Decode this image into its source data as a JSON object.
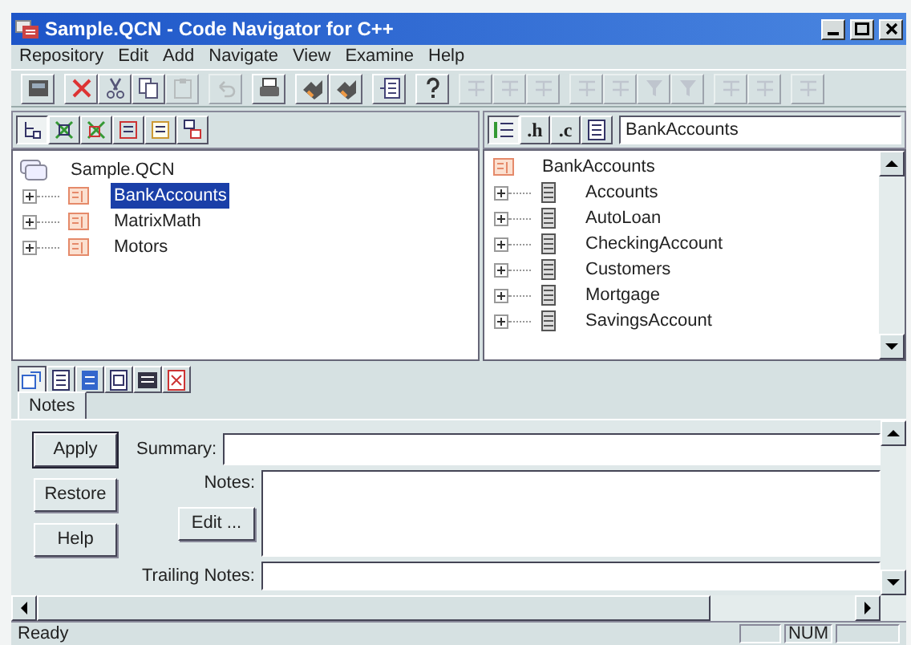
{
  "window": {
    "title": "Sample.QCN - Code Navigator for C++"
  },
  "menu": [
    "Repository",
    "Edit",
    "Add",
    "Navigate",
    "View",
    "Examine",
    "Help"
  ],
  "toolbar": [
    [
      {
        "kind": "database",
        "disabled": false
      }
    ],
    [
      {
        "kind": "delete",
        "disabled": false
      },
      {
        "kind": "cut",
        "disabled": false
      },
      {
        "kind": "copy",
        "disabled": false
      },
      {
        "kind": "paste",
        "disabled": true
      }
    ],
    [
      {
        "kind": "undo",
        "disabled": true
      }
    ],
    [
      {
        "kind": "print",
        "disabled": false
      }
    ],
    [
      {
        "kind": "link",
        "disabled": false
      },
      {
        "kind": "link",
        "disabled": false
      }
    ],
    [
      {
        "kind": "window",
        "disabled": false
      }
    ],
    [
      {
        "kind": "help",
        "disabled": false
      }
    ],
    [
      {
        "kind": "grid",
        "disabled": true
      },
      {
        "kind": "grid",
        "disabled": true
      },
      {
        "kind": "grid",
        "disabled": true
      }
    ],
    [
      {
        "kind": "grid",
        "disabled": true
      },
      {
        "kind": "grid",
        "disabled": true
      },
      {
        "kind": "filter",
        "disabled": true
      },
      {
        "kind": "filter",
        "disabled": true
      }
    ],
    [
      {
        "kind": "grid",
        "disabled": true
      },
      {
        "kind": "grid",
        "disabled": true
      }
    ],
    [
      {
        "kind": "grid",
        "disabled": true
      }
    ]
  ],
  "left_pane": {
    "tools": [
      {
        "selected": true
      },
      {
        "selected": false
      },
      {
        "selected": false
      },
      {
        "selected": false
      },
      {
        "selected": false
      },
      {
        "selected": false
      }
    ],
    "tree": {
      "label": "Sample.QCN",
      "children": [
        {
          "label": "BankAccounts",
          "selected": true,
          "expanded": false
        },
        {
          "label": "MatrixMath",
          "selected": false,
          "expanded": false
        },
        {
          "label": "Motors",
          "selected": false,
          "expanded": false
        }
      ]
    }
  },
  "right_pane": {
    "tools": [
      {
        "kind": "list",
        "selected": true
      },
      {
        "kind": "text",
        "label": ".h",
        "selected": false
      },
      {
        "kind": "text",
        "label": ".c",
        "selected": false
      },
      {
        "kind": "doc",
        "selected": false
      }
    ],
    "field": {
      "value": "BankAccounts"
    },
    "tree": {
      "label": "BankAccounts",
      "children": [
        {
          "label": "Accounts",
          "expanded": false
        },
        {
          "label": "AutoLoan",
          "expanded": false
        },
        {
          "label": "CheckingAccount",
          "expanded": false
        },
        {
          "label": "Customers",
          "expanded": false
        },
        {
          "label": "Mortgage",
          "expanded": false
        },
        {
          "label": "SavingsAccount",
          "expanded": false
        }
      ]
    }
  },
  "view_tabs": [
    {
      "selected": true
    },
    {
      "selected": false
    },
    {
      "selected": false
    },
    {
      "selected": false
    },
    {
      "selected": false
    },
    {
      "selected": false
    }
  ],
  "tabs": [
    {
      "label": "Notes",
      "selected": true
    }
  ],
  "notes": {
    "buttons": [
      "Apply",
      "Restore",
      "Help"
    ],
    "edit_button": "Edit ...",
    "summary_label": "Summary:",
    "notes_label": "Notes:",
    "trailing_label": "Trailing Notes:"
  },
  "status_bar": {
    "text": "Ready",
    "indicator": "NUM"
  }
}
